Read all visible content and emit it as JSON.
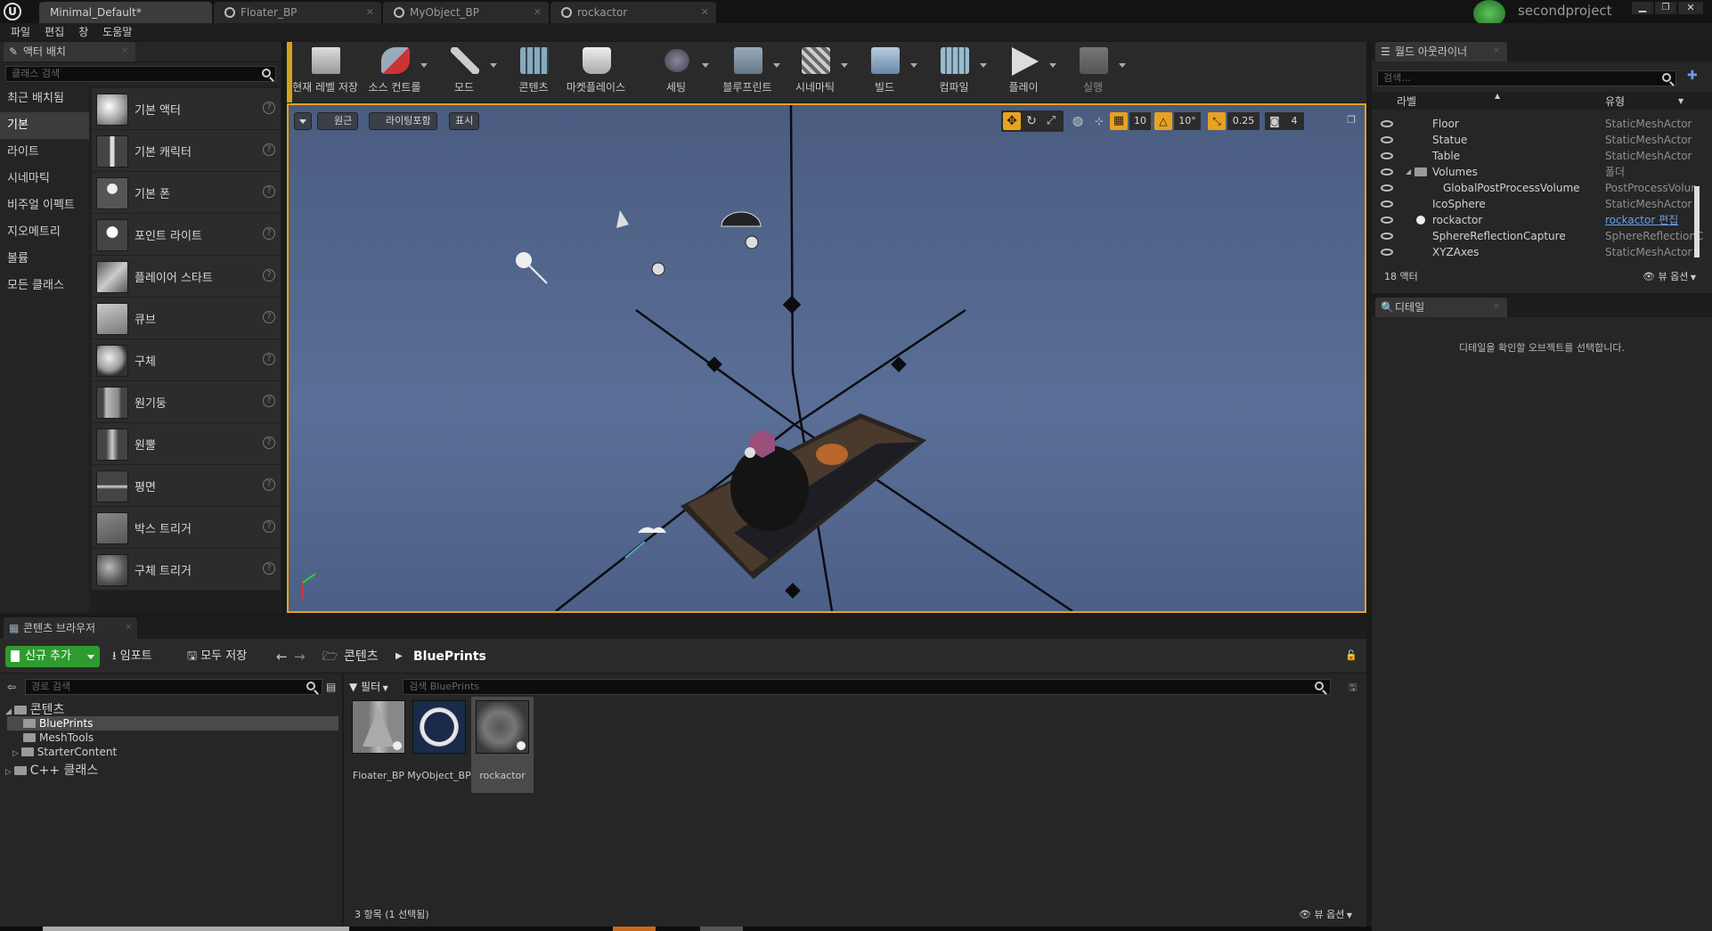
{
  "window": {
    "tabs": [
      "Minimal_Default*",
      "Floater_BP",
      "MyObject_BP",
      "rockactor"
    ],
    "project": "secondproject",
    "controls": [
      "minimize-icon",
      "restore-icon",
      "close-icon"
    ]
  },
  "menu": [
    "파일",
    "편집",
    "창",
    "도움말"
  ],
  "place_actors": {
    "title": "액터 배치",
    "search_placeholder": "클래스 검색",
    "categories": [
      "최근 배치됨",
      "기본",
      "라이트",
      "시네마틱",
      "비주얼 이펙트",
      "지오메트리",
      "볼륨",
      "모든 클래스"
    ],
    "selected_category": "기본",
    "items": [
      "기본 액터",
      "기본 캐릭터",
      "기본 폰",
      "포인트 라이트",
      "플레이어 스타트",
      "큐브",
      "구체",
      "원기둥",
      "원뿔",
      "평면",
      "박스 트리거",
      "구체 트리거"
    ]
  },
  "toolbar": {
    "buttons": [
      "현재 레벨 저장",
      "소스 컨트롤",
      "모드",
      "콘텐츠",
      "마켓플레이스",
      "세팅",
      "블루프린트",
      "시네마틱",
      "빌드",
      "컴파일",
      "플레이",
      "실행"
    ]
  },
  "viewport": {
    "perspective": "원근",
    "lighting": "라이팅포함",
    "show": "표시",
    "grid_snap": "10",
    "rotation_snap": "10°",
    "scale_snap": "0.25",
    "camera_speed": "4"
  },
  "content_browser": {
    "title": "콘텐츠 브라우저",
    "add_new": "신규 추가",
    "import": "임포트",
    "save_all": "모두 저장",
    "path": [
      "콘텐츠",
      "BluePrints"
    ],
    "path_search_placeholder": "경로 검색",
    "filter_label": "필터",
    "asset_search_placeholder": "검색 BluePrints",
    "tree": {
      "root": "콘텐츠",
      "folders": [
        "BluePrints",
        "MeshTools",
        "StarterContent"
      ],
      "cpp": "C++ 클래스"
    },
    "assets": [
      "Floater_BP",
      "MyObject_BP",
      "rockactor"
    ],
    "status": "3 항목 (1 선택됨)",
    "view_options": "뷰 옵션"
  },
  "outliner": {
    "title": "월드 아웃라이너",
    "search_placeholder": "검색...",
    "col_label": "라벨",
    "col_type": "유형",
    "rows": [
      {
        "name": "Floor",
        "type": "StaticMeshActor"
      },
      {
        "name": "Statue",
        "type": "StaticMeshActor"
      },
      {
        "name": "Table",
        "type": "StaticMeshActor"
      },
      {
        "name": "Volumes",
        "type": "폴더"
      },
      {
        "name": "GlobalPostProcessVolume",
        "type": "PostProcessVolur"
      },
      {
        "name": "IcoSphere",
        "type": "StaticMeshActor"
      },
      {
        "name": "rockactor",
        "type": "rockactor 편집"
      },
      {
        "name": "SphereReflectionCapture",
        "type": "SphereReflectionC"
      },
      {
        "name": "XYZAxes",
        "type": "StaticMeshActor"
      }
    ],
    "count": "18 액터",
    "view_options": "뷰 옵션"
  },
  "details": {
    "title": "디테일",
    "message": "디테일을 확인할 오브젝트를 선택합니다."
  },
  "colors": {
    "accent": "#e8a21e",
    "add_button": "#2e9b2e",
    "link": "#6a9ee8"
  }
}
